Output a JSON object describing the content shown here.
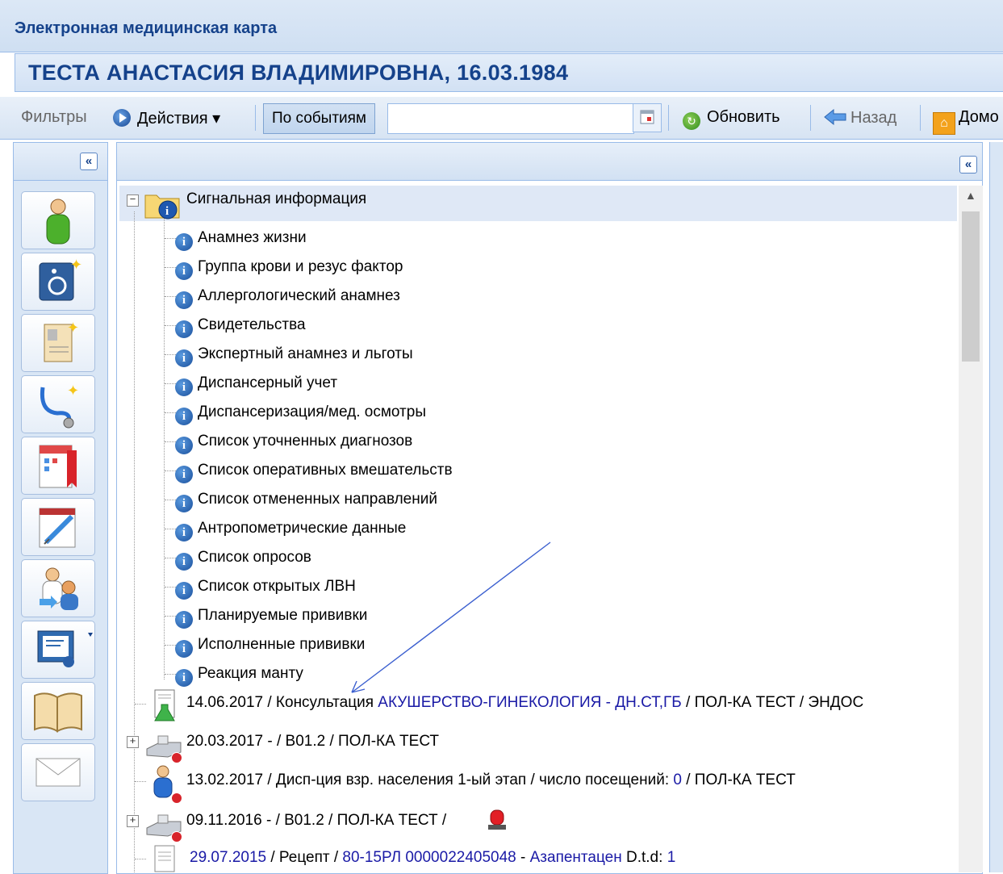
{
  "window": {
    "title": "Электронная медицинская карта"
  },
  "patient": {
    "header": "ТЕСТА АНАСТАСИЯ ВЛАДИМИРОВНА, 16.03.1984"
  },
  "toolbar": {
    "filters_label": "Фильтры",
    "actions_label": "Действия ▾",
    "by_events_label": "По событиям",
    "filter_value": "",
    "refresh_label": "Обновить",
    "back_label": "Назад",
    "home_label": "Домо"
  },
  "left_panel": {
    "collapse_glyph": "«",
    "buttons": [
      "patient-icon",
      "disability-icon",
      "document-card-icon",
      "stethoscope-icon",
      "calendar-bookmark-icon",
      "calendar-syringe-icon",
      "doctor-referral-icon",
      "certificate-icon",
      "book-icon",
      "envelope-icon"
    ]
  },
  "tree": {
    "collapse_glyph": "«",
    "root_label": "Сигнальная информация",
    "children": [
      "Анамнез жизни",
      "Группа крови и резус фактор",
      "Аллергологический анамнез",
      "Свидетельства",
      "Экспертный анамнез и льготы",
      "Диспансерный учет",
      "Диспансеризация/мед. осмотры",
      "Список уточненных диагнозов",
      "Список оперативных вмешательств",
      "Список отмененных направлений",
      "Антропометрические данные",
      "Список опросов",
      "Список открытых ЛВН",
      "Планируемые прививки",
      "Исполненные прививки",
      "Реакция манту"
    ],
    "events": [
      {
        "pre": "14.06.2017 / Консультация ",
        "link": "АКУШЕРСТВО-ГИНЕКОЛОГИЯ - ДН.СТ,ГБ",
        "post": " / ПОЛ-КА ТЕСТ / ЭНДОС"
      },
      {
        "pre": "20.03.2017 - / В01.2 / ПОЛ-КА ТЕСТ",
        "link": "",
        "post": ""
      },
      {
        "pre": "13.02.2017 / Дисп-ция взр. населения 1-ый этап / число посещений: ",
        "link": "0",
        "post": " / ПОЛ-КА ТЕСТ"
      },
      {
        "pre": "09.11.2016 - / В01.2 / ПОЛ-КА ТЕСТ /",
        "link": "",
        "post": ""
      },
      {
        "pre": "",
        "link": "29.07.2015",
        "post": " / Рецепт / ",
        "link2": "80-15РЛ 0000022405048",
        "mid": " - ",
        "link3": "Азапентацен",
        "post2": " D.t.d: ",
        "link4": "1"
      }
    ]
  }
}
